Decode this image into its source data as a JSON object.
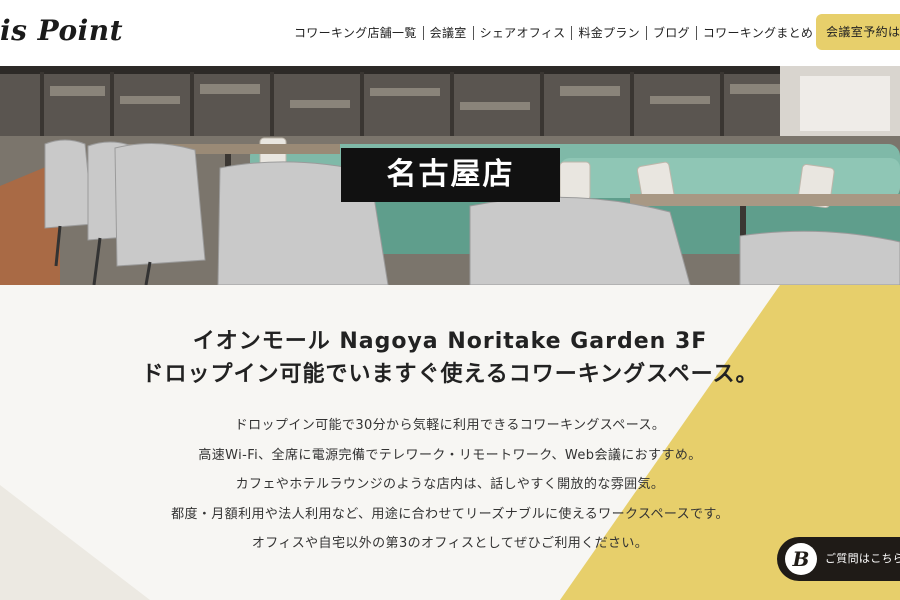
{
  "header": {
    "logo_text": "is Point",
    "nav": [
      "コワーキング店舗一覧",
      "会議室",
      "シェアオフィス",
      "料金プラン",
      "ブログ",
      "コワーキングまとめ"
    ],
    "cta_label": "会議室予約はこ"
  },
  "hero": {
    "title": "名古屋店"
  },
  "intro": {
    "headline_line1": "イオンモール Nagoya Noritake Garden 3F",
    "headline_line2": "ドロップイン可能でいますぐ使えるコワーキングスペース。",
    "body_lines": [
      "ドロップイン可能で30分から気軽に利用できるコワーキングスペース。",
      "高速Wi-Fi、全席に電源完備でテレワーク・リモートワーク、Web会議におすすめ。",
      "カフェやホテルラウンジのような店内は、話しやすく開放的な雰囲気。",
      "都度・月額利用や法人利用など、用途に合わせてリーズナブルに使えるワークスペースです。",
      "オフィスや自宅以外の第3のオフィスとしてぜひご利用ください。"
    ]
  },
  "faq": {
    "badge": "B",
    "label": "ご質問はこちら"
  },
  "colors": {
    "accent_yellow": "#e7cf6b",
    "dark": "#1f1b17"
  }
}
